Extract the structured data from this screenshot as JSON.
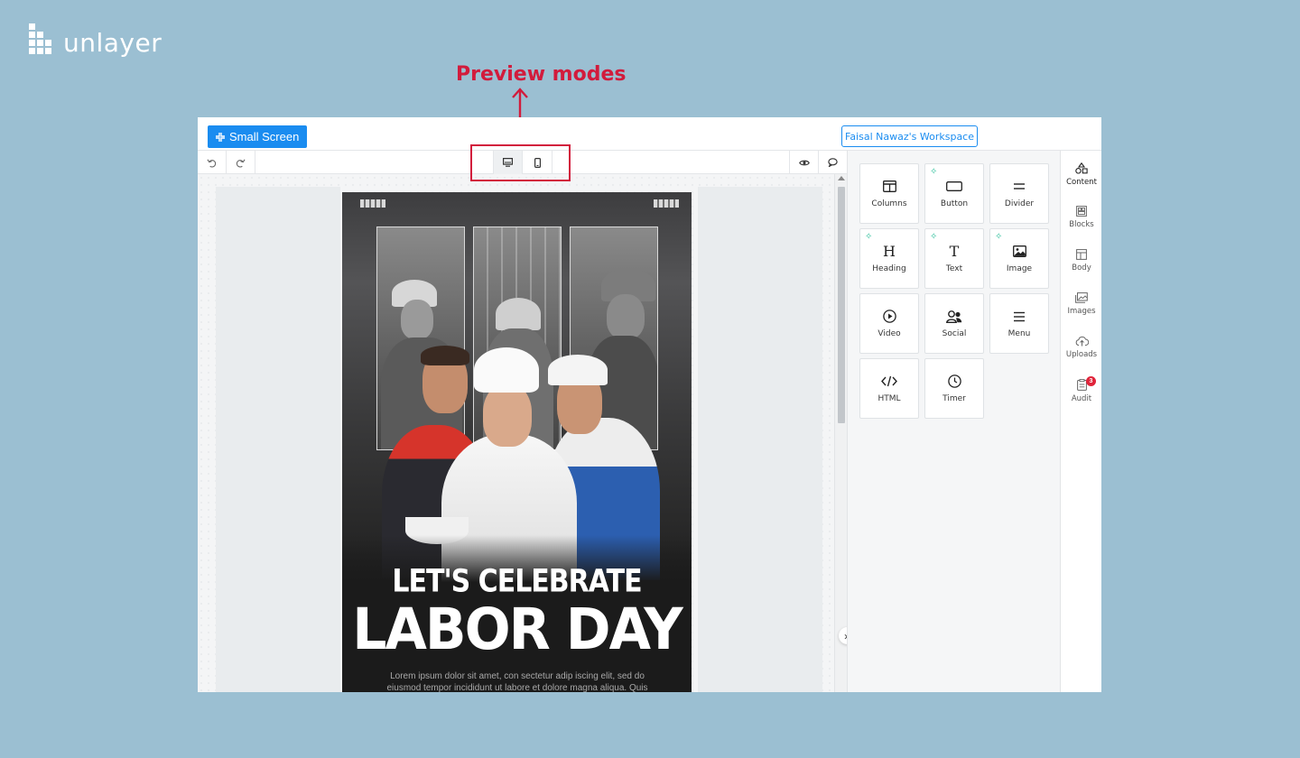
{
  "brand": {
    "name": "unlayer"
  },
  "annotation": {
    "label": "Preview modes",
    "color": "#d21b3c"
  },
  "header": {
    "small_screen_label": "Small Screen",
    "workspace_label": "Faisal Nawaz's Workspace"
  },
  "toolbar": {
    "undo_icon": "undo-icon",
    "redo_icon": "redo-icon",
    "devices": [
      "desktop-icon",
      "mobile-icon"
    ],
    "active_device": "desktop",
    "preview_icon": "eye-icon",
    "comments_icon": "comment-icon"
  },
  "email": {
    "title_line1": "LET'S CELEBRATE",
    "title_line2": "LABOR DAY",
    "body_text": "Lorem ipsum dolor sit amet, con sectetur adip iscing elit, sed do eiusmod tempor incididunt ut labore et dolore magna aliqua. Quis"
  },
  "tools": [
    {
      "label": "Columns",
      "icon": "columns-icon",
      "new": false
    },
    {
      "label": "Button",
      "icon": "button-icon",
      "new": true
    },
    {
      "label": "Divider",
      "icon": "divider-icon",
      "new": false
    },
    {
      "label": "Heading",
      "icon": "heading-icon",
      "new": true
    },
    {
      "label": "Text",
      "icon": "text-icon",
      "new": true
    },
    {
      "label": "Image",
      "icon": "image-icon",
      "new": true
    },
    {
      "label": "Video",
      "icon": "video-icon",
      "new": false
    },
    {
      "label": "Social",
      "icon": "social-icon",
      "new": false
    },
    {
      "label": "Menu",
      "icon": "menu-icon",
      "new": false
    },
    {
      "label": "HTML",
      "icon": "html-icon",
      "new": false
    },
    {
      "label": "Timer",
      "icon": "timer-icon",
      "new": false
    }
  ],
  "nav": [
    {
      "label": "Content",
      "icon": "shapes-icon",
      "active": true
    },
    {
      "label": "Blocks",
      "icon": "blocks-icon",
      "active": false
    },
    {
      "label": "Body",
      "icon": "body-icon",
      "active": false
    },
    {
      "label": "Images",
      "icon": "images-icon",
      "active": false
    },
    {
      "label": "Uploads",
      "icon": "upload-icon",
      "active": false
    },
    {
      "label": "Audit",
      "icon": "audit-icon",
      "active": false,
      "badge": "3"
    }
  ],
  "colors": {
    "accent": "#1a8cf0",
    "background": "#9bbfd2",
    "new_marker": "#2dbf9a",
    "badge": "#e0243a"
  }
}
